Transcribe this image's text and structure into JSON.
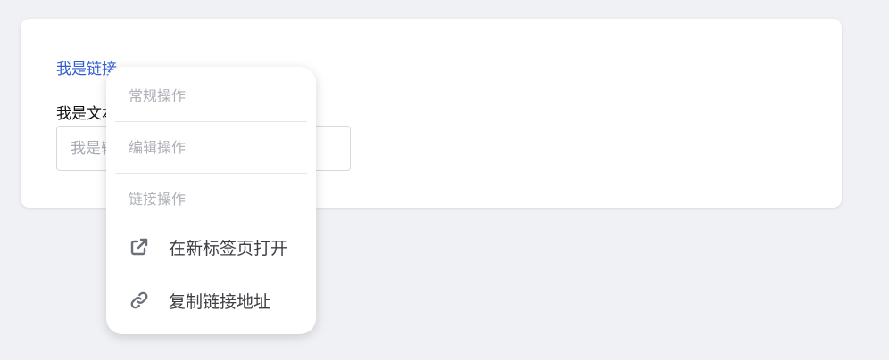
{
  "content": {
    "link_text": "我是链接",
    "text_label": "我是文本",
    "input_placeholder": "我是输入框"
  },
  "context_menu": {
    "groups": [
      {
        "label": "常规操作"
      },
      {
        "label": "编辑操作"
      },
      {
        "label": "链接操作",
        "items": [
          {
            "label": "在新标签页打开",
            "icon": "open-in-new-tab-icon"
          },
          {
            "label": "复制链接地址",
            "icon": "link-icon"
          }
        ]
      }
    ]
  },
  "colors": {
    "page_background": "#f0f1f5",
    "card_background": "#ffffff",
    "link": "#2f5bd3",
    "muted_text": "#aeb1b8",
    "menu_text": "#3f4046"
  }
}
